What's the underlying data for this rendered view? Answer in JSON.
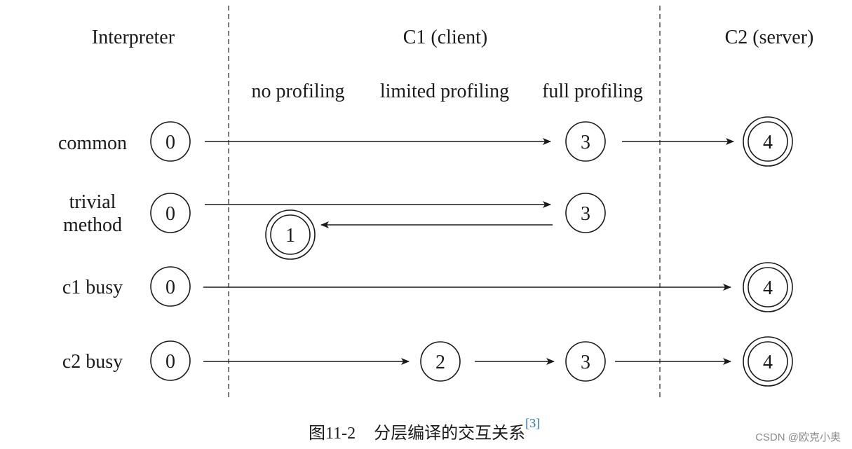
{
  "diagram": {
    "columns": [
      {
        "id": "interpreter",
        "label": "Interpreter"
      },
      {
        "id": "c1",
        "label": "C1 (client)"
      },
      {
        "id": "c2",
        "label": "C2 (server)"
      }
    ],
    "sub_columns": [
      "no profiling",
      "limited profiling",
      "full profiling"
    ],
    "rows": [
      {
        "label_lines": [
          "common"
        ],
        "nodes": [
          {
            "level": "0",
            "kind": "single"
          },
          {
            "level": "3",
            "kind": "single"
          },
          {
            "level": "4",
            "kind": "double"
          }
        ],
        "edges": [
          {
            "from": "0",
            "to": "3"
          },
          {
            "from": "3",
            "to": "4"
          }
        ]
      },
      {
        "label_lines": [
          "trivial",
          "method"
        ],
        "nodes": [
          {
            "level": "0",
            "kind": "single"
          },
          {
            "level": "3",
            "kind": "single"
          },
          {
            "level": "1",
            "kind": "double"
          }
        ],
        "edges": [
          {
            "from": "0",
            "to": "3"
          },
          {
            "from": "3",
            "to": "1"
          }
        ]
      },
      {
        "label_lines": [
          "c1 busy"
        ],
        "nodes": [
          {
            "level": "0",
            "kind": "single"
          },
          {
            "level": "4",
            "kind": "double"
          }
        ],
        "edges": [
          {
            "from": "0",
            "to": "4"
          }
        ]
      },
      {
        "label_lines": [
          "c2 busy"
        ],
        "nodes": [
          {
            "level": "0",
            "kind": "single"
          },
          {
            "level": "2",
            "kind": "single"
          },
          {
            "level": "3",
            "kind": "single"
          },
          {
            "level": "4",
            "kind": "double"
          }
        ],
        "edges": [
          {
            "from": "0",
            "to": "2"
          },
          {
            "from": "2",
            "to": "3"
          },
          {
            "from": "3",
            "to": "4"
          }
        ]
      }
    ]
  },
  "caption": {
    "figure_number": "图11-2",
    "text": "分层编译的交互关系",
    "reference": "[3]"
  },
  "watermark": "CSDN @欧克小奥",
  "colors": {
    "ink": "#1a1a1a",
    "reference": "#1a6fb8",
    "watermark": "#8a8a8a"
  }
}
